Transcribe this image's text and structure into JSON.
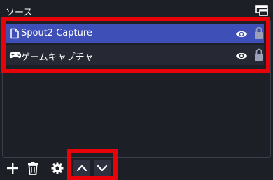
{
  "dock": {
    "title": "ソース",
    "float_icon": "undock-icon"
  },
  "sources": [
    {
      "name": "Spout2 Capture",
      "type_icon": "file-icon",
      "visible_icon": "eye-icon",
      "lock_icon": "lock-icon",
      "selected": true
    },
    {
      "name": "ゲームキャプチャ",
      "type_icon": "gamepad-icon",
      "visible_icon": "eye-icon",
      "lock_icon": "lock-icon",
      "selected": false
    }
  ],
  "toolbar": {
    "add_icon": "plus-icon",
    "remove_icon": "trash-icon",
    "properties_icon": "gear-icon",
    "move_up_icon": "chevron-up-icon",
    "move_down_icon": "chevron-down-icon"
  },
  "colors": {
    "background": "#1d1f26",
    "selected_row": "#3e4fb7",
    "row": "#262833",
    "highlight": "#e8030b"
  }
}
